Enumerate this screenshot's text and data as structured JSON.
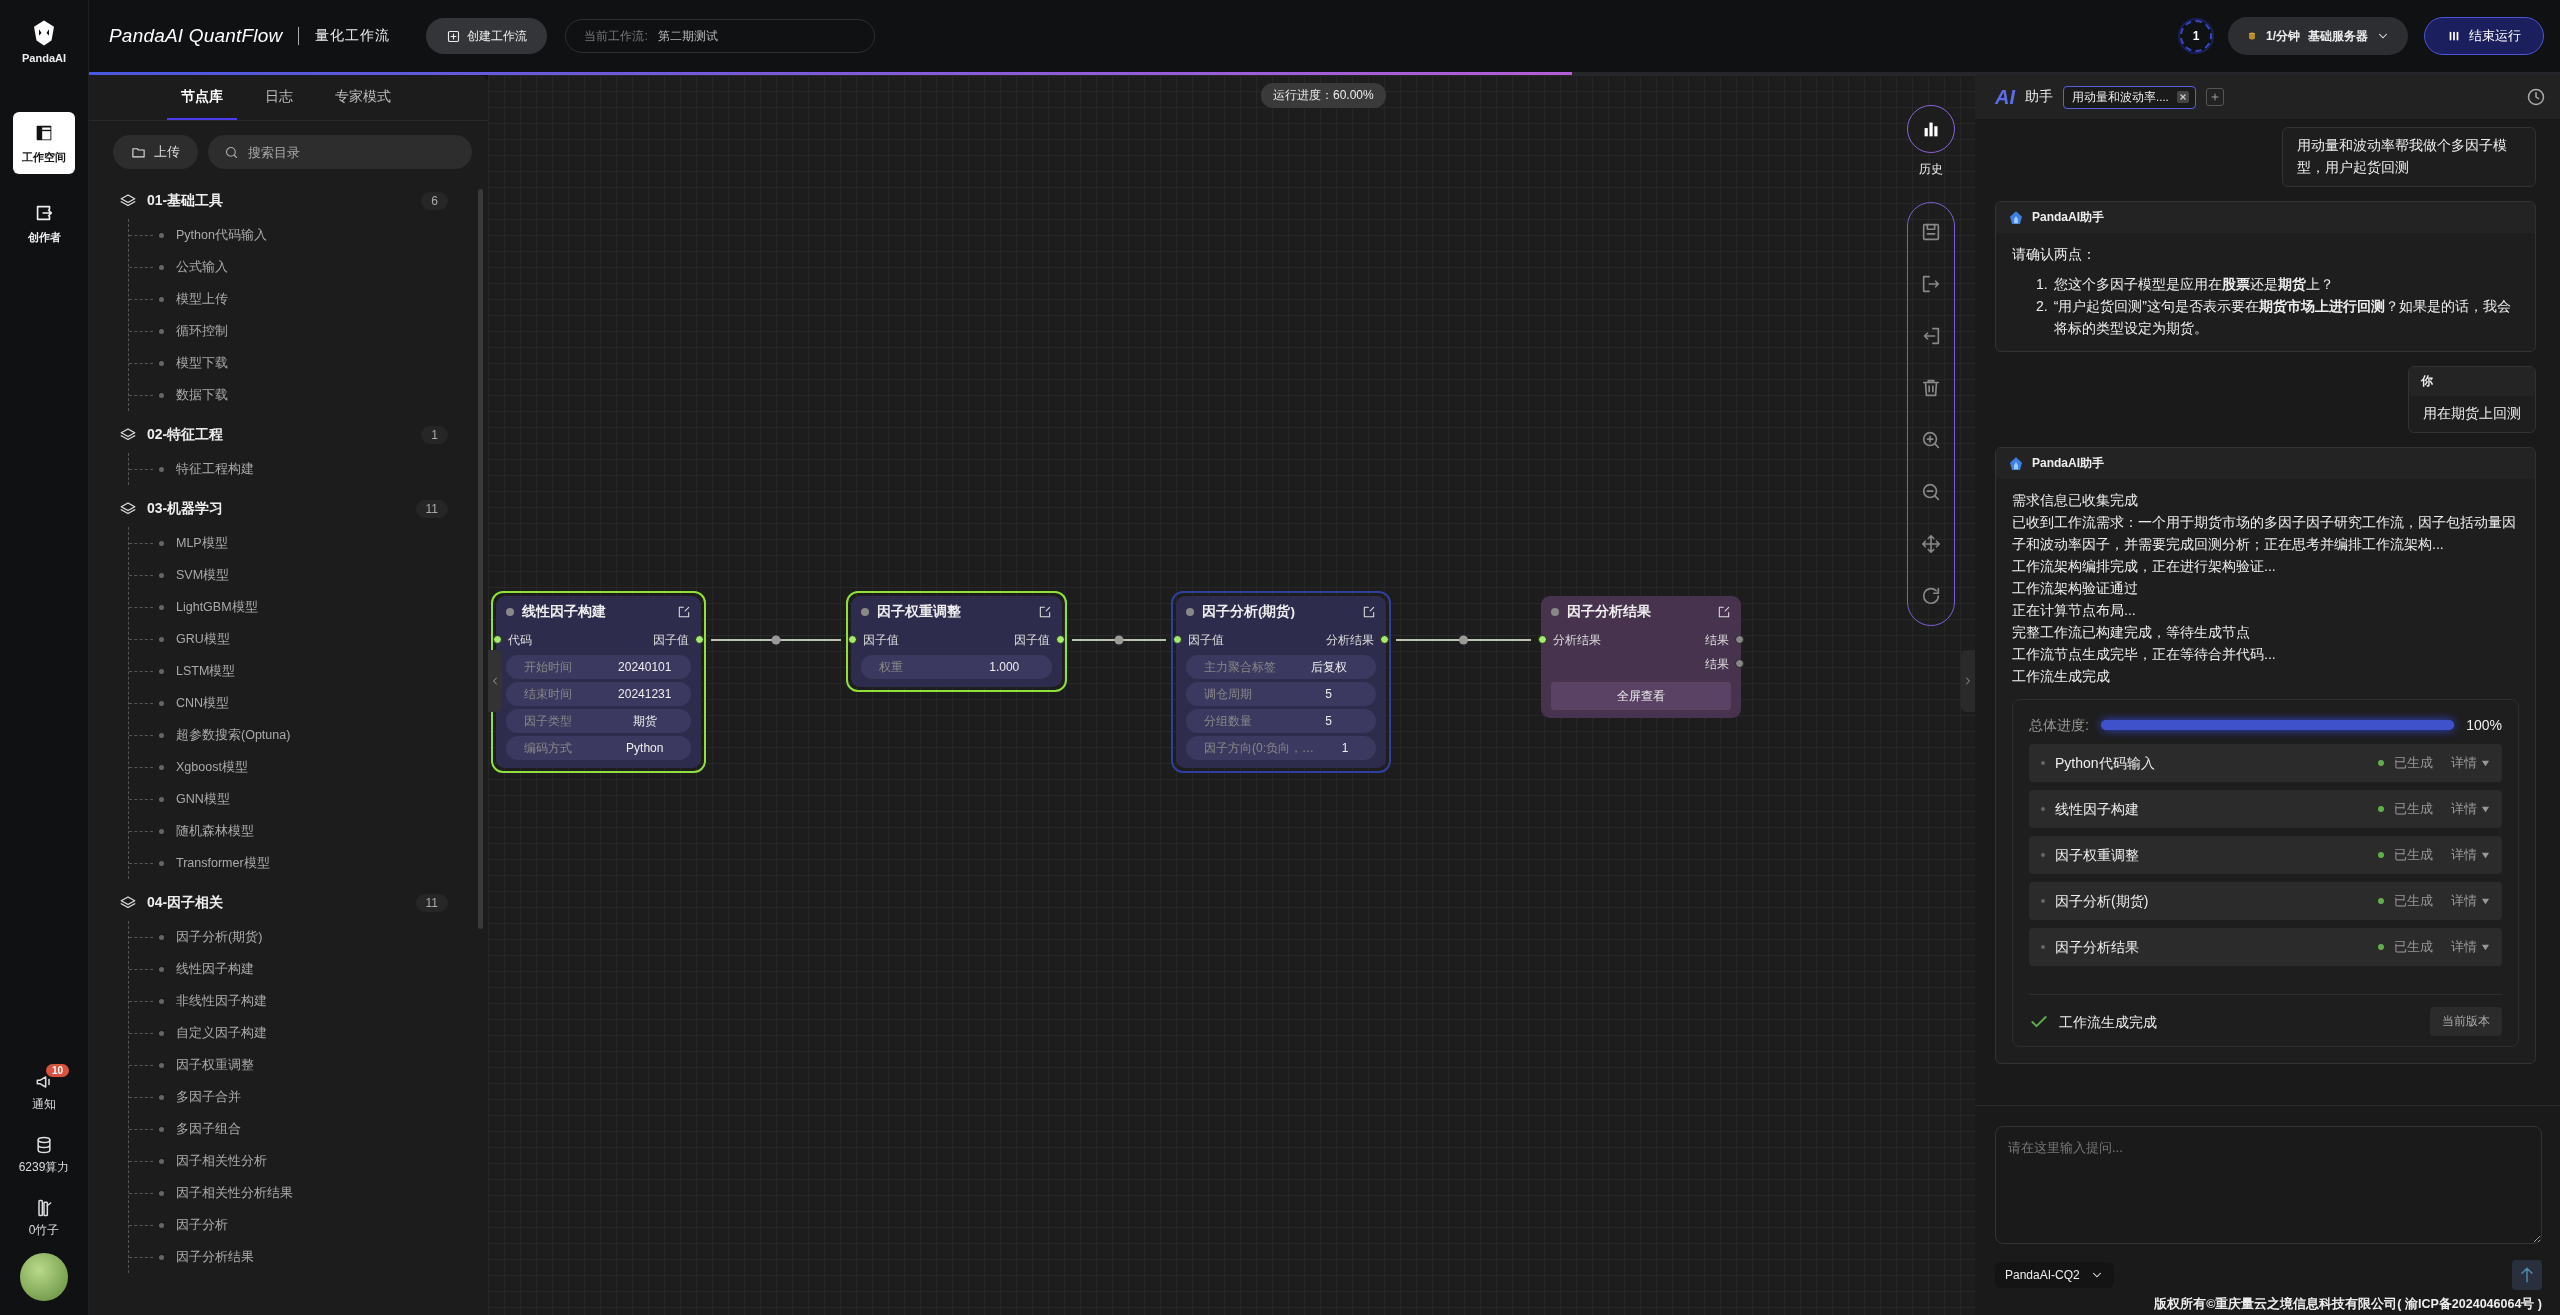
{
  "rail": {
    "logo": "PandaAI",
    "nav": [
      {
        "kind": "workspace",
        "label": "工作空间",
        "selected": true
      },
      {
        "kind": "creator",
        "label": "创作者",
        "selected": false
      }
    ],
    "tools": [
      {
        "kind": "notice",
        "label": "通知",
        "badge": "10"
      },
      {
        "kind": "compute",
        "label": "6239算力"
      },
      {
        "kind": "bamboo",
        "label": "0竹子"
      }
    ]
  },
  "header": {
    "title": "PandaAI QuantFlow",
    "subtitle": "量化工作流",
    "create_button": "创建工作流",
    "workflow_field": {
      "label": "当前工作流:",
      "value": "第二期测试"
    },
    "queue_count": "1",
    "server": {
      "rate": "1/分钟",
      "name": "基础服务器"
    },
    "stop_button": "结束运行"
  },
  "run_progress": {
    "label": "运行进度：60.00%",
    "level": 0.6
  },
  "sidebar": {
    "tabs": [
      {
        "label": "节点库",
        "selected": true
      },
      {
        "label": "日志",
        "selected": false
      },
      {
        "label": "专家模式",
        "selected": false
      }
    ],
    "upload_button": "上传",
    "search": {
      "placeholder": "搜索目录"
    },
    "groups": [
      {
        "title": "01-基础工具",
        "count": "6",
        "children": [
          {
            "label": "Python代码输入"
          },
          {
            "label": "公式输入"
          },
          {
            "label": "模型上传"
          },
          {
            "label": "循环控制"
          },
          {
            "label": "模型下载"
          },
          {
            "label": "数据下载"
          }
        ]
      },
      {
        "title": "02-特征工程",
        "count": "1",
        "children": [
          {
            "label": "特征工程构建"
          }
        ]
      },
      {
        "title": "03-机器学习",
        "count": "11",
        "children": [
          {
            "label": "MLP模型"
          },
          {
            "label": "SVM模型"
          },
          {
            "label": "LightGBM模型"
          },
          {
            "label": "GRU模型"
          },
          {
            "label": "LSTM模型"
          },
          {
            "label": "CNN模型"
          },
          {
            "label": "超参数搜索(Optuna)"
          },
          {
            "label": "Xgboost模型"
          },
          {
            "label": "GNN模型"
          },
          {
            "label": "随机森林模型"
          },
          {
            "label": "Transformer模型"
          }
        ]
      },
      {
        "title": "04-因子相关",
        "count": "11",
        "children": [
          {
            "label": "因子分析(期货)"
          },
          {
            "label": "线性因子构建"
          },
          {
            "label": "非线性因子构建"
          },
          {
            "label": "自定义因子构建"
          },
          {
            "label": "因子权重调整"
          },
          {
            "label": "多因子合并"
          },
          {
            "label": "多因子组合"
          },
          {
            "label": "因子相关性分析"
          },
          {
            "label": "因子相关性分析结果"
          },
          {
            "label": "因子分析"
          },
          {
            "label": "因子分析结果"
          }
        ]
      }
    ]
  },
  "canvas": {
    "history_button": "历史",
    "nodes": [
      {
        "kind": "process",
        "title": "线性因子构建",
        "color": "#8fe03a",
        "inputs": [
          {
            "label": "代码",
            "connected": true
          }
        ],
        "outputs": [
          {
            "label": "因子值",
            "connected": true
          }
        ],
        "params": [
          {
            "label": "开始时间",
            "value": "20240101"
          },
          {
            "label": "结束时间",
            "value": "20241231"
          },
          {
            "label": "因子类型",
            "value": "期货"
          },
          {
            "label": "编码方式",
            "value": "Python"
          }
        ]
      },
      {
        "kind": "process",
        "title": "因子权重调整",
        "color": "#8fe03a",
        "inputs": [
          {
            "label": "因子值",
            "connected": true
          }
        ],
        "outputs": [
          {
            "label": "因子值",
            "connected": true
          }
        ],
        "params": [
          {
            "label": "权重",
            "value": "1.000"
          }
        ]
      },
      {
        "kind": "process",
        "title": "因子分析(期货)",
        "color": "#2e3f9e",
        "inputs": [
          {
            "label": "因子值",
            "connected": true
          }
        ],
        "outputs": [
          {
            "label": "分析结果",
            "connected": true
          }
        ],
        "params": [
          {
            "label": "主力聚合标签",
            "value": "后复权"
          },
          {
            "label": "调仓周期",
            "value": "5"
          },
          {
            "label": "分组数量",
            "value": "5"
          },
          {
            "label": "因子方向(0:负向，…",
            "value": "1"
          }
        ]
      },
      {
        "kind": "output",
        "title": "因子分析结果",
        "inputs": [
          {
            "label": "分析结果",
            "connected": true
          }
        ],
        "outputs": [
          {
            "label": "结果",
            "connected": false
          },
          {
            "label": "结果",
            "connected": false
          }
        ],
        "button": "全屏查看"
      }
    ]
  },
  "chat": {
    "logo": "AI",
    "title": "助手",
    "tab": "用动量和波动率....",
    "messages": [
      {
        "kind": "user",
        "text": "用动量和波动率帮我做个多因子模型，用户起货回测"
      },
      {
        "kind": "assistant",
        "name": "PandaAI助手",
        "intro": "请确认两点：",
        "items": [
          {
            "marker": "1.",
            "text": "您这个多因子模型是应用在**股票**还是**期货**上？"
          },
          {
            "marker": "2.",
            "text": "“用户起货回测”这句是否表示要在**期货市场上进行回测**？如果是的话，我会将标的类型设定为期货。"
          }
        ]
      },
      {
        "kind": "user",
        "name": "你",
        "text": "用在期货上回测"
      },
      {
        "kind": "assistant",
        "name": "PandaAI助手",
        "lines": [
          "需求信息已收集完成",
          "已收到工作流需求：一个用于期货市场的多因子因子研究工作流，因子包括动量因子和波动率因子，并需要完成回测分析；正在思考并编排工作流架构...",
          "工作流架构编排完成，正在进行架构验证...",
          "工作流架构验证通过",
          "正在计算节点布局...",
          "完整工作流已构建完成，等待生成节点",
          "工作流节点生成完毕，正在等待合并代码...",
          "工作流生成完成"
        ],
        "progress": {
          "label": "总体进度:",
          "level": 1,
          "percent": "100%",
          "steps": [
            {
              "name": "Python代码输入",
              "status": "已生成",
              "done": true,
              "details": "详情"
            },
            {
              "name": "线性因子构建",
              "status": "已生成",
              "done": true,
              "details": "详情"
            },
            {
              "name": "因子权重调整",
              "status": "已生成",
              "done": true,
              "details": "详情"
            },
            {
              "name": "因子分析(期货)",
              "status": "已生成",
              "done": true,
              "details": "详情"
            },
            {
              "name": "因子分析结果",
              "status": "已生成",
              "done": true,
              "details": "详情"
            }
          ],
          "result": "工作流生成完成",
          "version_button": "当前版本"
        }
      }
    ],
    "input": {
      "placeholder": "请在这里输入提问..."
    },
    "model": "PandaAI-CQ2"
  },
  "footer": "版权所有©重庆量云之境信息科技有限公司( 渝ICP备2024046064号 )"
}
